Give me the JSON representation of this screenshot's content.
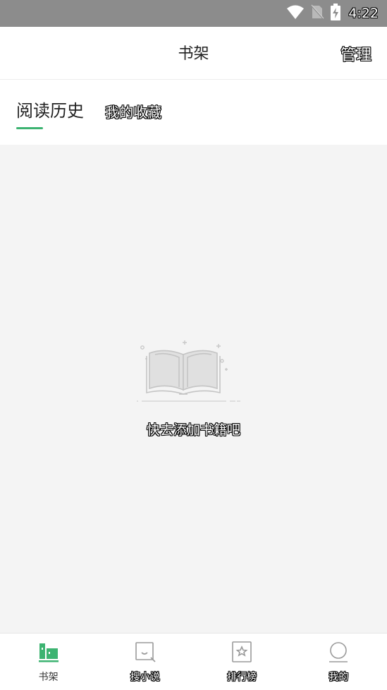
{
  "status_bar": {
    "time": "4:22",
    "icons": [
      "wifi-icon",
      "no-sim-icon",
      "battery-charging-icon"
    ]
  },
  "header": {
    "title": "书架",
    "manage_label": "管理"
  },
  "tabs": [
    {
      "label": "阅读历史",
      "active": true
    },
    {
      "label": "我的收藏",
      "active": false
    }
  ],
  "empty_state": {
    "icon": "open-book-icon",
    "message": "快去添加书籍吧"
  },
  "bottom_nav": [
    {
      "label": "书架",
      "icon": "bookshelf-icon",
      "active": true
    },
    {
      "label": "搜小说",
      "icon": "search-novel-icon",
      "active": false
    },
    {
      "label": "排行榜",
      "icon": "ranking-icon",
      "active": false
    },
    {
      "label": "我的",
      "icon": "profile-icon",
      "active": false
    }
  ],
  "colors": {
    "accent": "#3cb371",
    "status_bar": "#8c8c8c",
    "background": "#f4f4f4"
  }
}
